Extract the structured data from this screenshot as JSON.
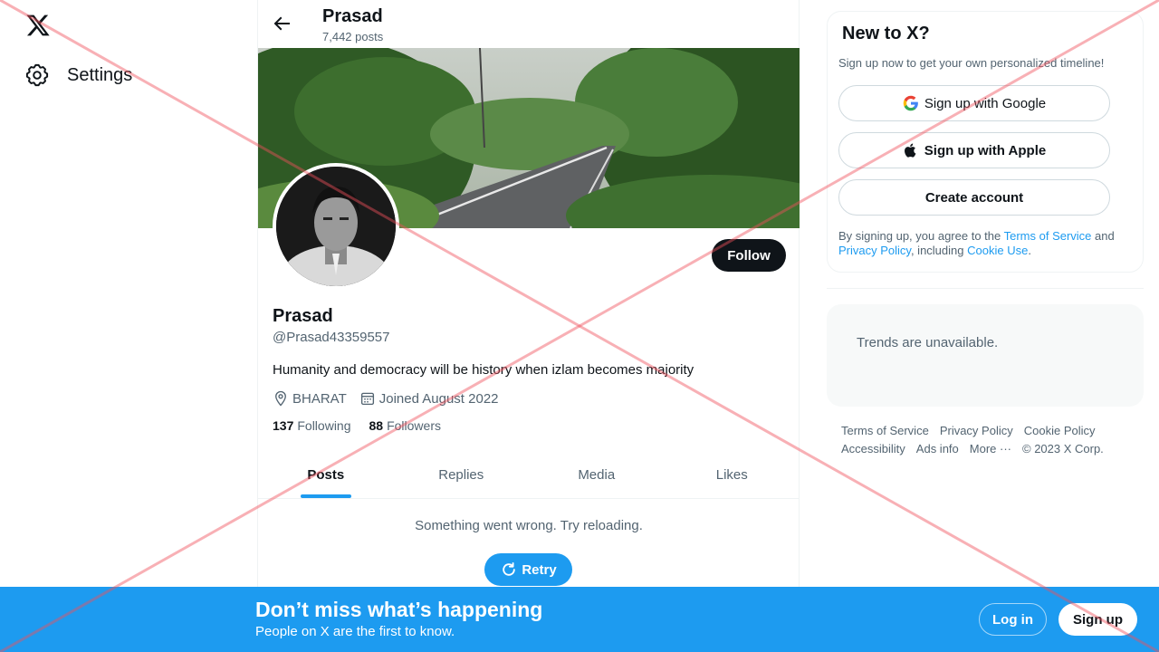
{
  "nav": {
    "logo_icon": "x-logo-icon",
    "settings_label": "Settings"
  },
  "header": {
    "title": "Prasad",
    "post_count": "7,442 posts"
  },
  "profile": {
    "follow_label": "Follow",
    "name": "Prasad",
    "handle": "@Prasad43359557",
    "bio": "Humanity and democracy will be history when izlam becomes majority",
    "location": "BHARAT",
    "joined": "Joined August 2022",
    "following_count": "137",
    "following_label": "Following",
    "followers_count": "88",
    "followers_label": "Followers"
  },
  "tabs": [
    {
      "label": "Posts"
    },
    {
      "label": "Replies"
    },
    {
      "label": "Media"
    },
    {
      "label": "Likes"
    }
  ],
  "feed": {
    "error_message": "Something went wrong. Try reloading.",
    "retry_label": "Retry"
  },
  "signup_card": {
    "title": "New to X?",
    "subtitle": "Sign up now to get your own personalized timeline!",
    "google_label": "Sign up with Google",
    "apple_label": "Sign up with Apple",
    "create_label": "Create account",
    "terms_prefix": "By signing up, you agree to the ",
    "terms_link": "Terms of Service",
    "terms_and": " and ",
    "privacy_link": "Privacy Policy",
    "terms_including": ", including ",
    "cookie_link": "Cookie Use",
    "terms_suffix": "."
  },
  "trends": {
    "message": "Trends are unavailable."
  },
  "footer": {
    "terms": "Terms of Service",
    "privacy": "Privacy Policy",
    "cookie": "Cookie Policy",
    "accessibility": "Accessibility",
    "ads": "Ads info",
    "more": "More ···",
    "copyright": "© 2023 X Corp."
  },
  "bottom_bar": {
    "title": "Don’t miss what’s happening",
    "subtitle": "People on X are the first to know.",
    "login_label": "Log in",
    "signup_label": "Sign up"
  },
  "colors": {
    "accent": "#1d9bf0",
    "text": "#0f1419",
    "muted": "#536471"
  }
}
